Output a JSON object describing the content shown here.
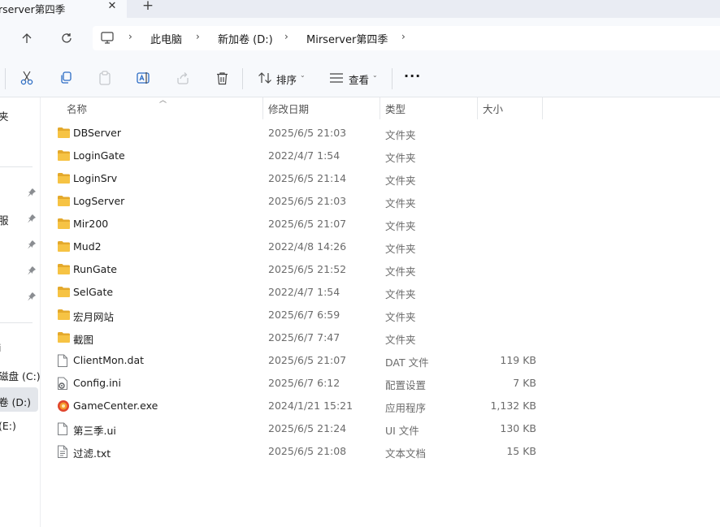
{
  "tab": {
    "title": "rserver第四季",
    "close_glyph": "✕",
    "new_glyph": "+"
  },
  "address": {
    "computer_icon": "monitor-icon",
    "crumbs": [
      "此电脑",
      "新加卷 (D:)",
      "Mirserver第四季"
    ]
  },
  "toolbar": {
    "sort_label": "排序",
    "view_label": "查看",
    "more_label": "···"
  },
  "sidebar": {
    "items": [
      {
        "label": "夹",
        "pinned": false
      },
      {
        "label": "",
        "pinned": true
      },
      {
        "label": "服",
        "pinned": true
      },
      {
        "label": "",
        "pinned": true
      },
      {
        "label": "",
        "pinned": true
      },
      {
        "label": "",
        "pinned": true
      },
      {
        "label": "i",
        "pinned": false
      },
      {
        "label": "磁盘 (C:)",
        "pinned": false
      },
      {
        "label": "卷 (D:)",
        "pinned": false
      },
      {
        "label": "(E:)",
        "pinned": false
      }
    ]
  },
  "columns": {
    "name": "名称",
    "date": "修改日期",
    "type": "类型",
    "size": "大小"
  },
  "files": [
    {
      "name": "DBServer",
      "date": "2025/6/5 21:03",
      "type": "文件夹",
      "size": "",
      "icon": "folder"
    },
    {
      "name": "LoginGate",
      "date": "2022/4/7 1:54",
      "type": "文件夹",
      "size": "",
      "icon": "folder"
    },
    {
      "name": "LoginSrv",
      "date": "2025/6/5 21:14",
      "type": "文件夹",
      "size": "",
      "icon": "folder"
    },
    {
      "name": "LogServer",
      "date": "2025/6/5 21:03",
      "type": "文件夹",
      "size": "",
      "icon": "folder"
    },
    {
      "name": "Mir200",
      "date": "2025/6/5 21:07",
      "type": "文件夹",
      "size": "",
      "icon": "folder"
    },
    {
      "name": "Mud2",
      "date": "2022/4/8 14:26",
      "type": "文件夹",
      "size": "",
      "icon": "folder"
    },
    {
      "name": "RunGate",
      "date": "2025/6/5 21:52",
      "type": "文件夹",
      "size": "",
      "icon": "folder"
    },
    {
      "name": "SelGate",
      "date": "2022/4/7 1:54",
      "type": "文件夹",
      "size": "",
      "icon": "folder"
    },
    {
      "name": "宏月网站",
      "date": "2025/6/7 6:59",
      "type": "文件夹",
      "size": "",
      "icon": "folder"
    },
    {
      "name": "截图",
      "date": "2025/6/7 7:47",
      "type": "文件夹",
      "size": "",
      "icon": "folder"
    },
    {
      "name": "ClientMon.dat",
      "date": "2025/6/5 21:07",
      "type": "DAT 文件",
      "size": "119 KB",
      "icon": "file"
    },
    {
      "name": "Config.ini",
      "date": "2025/6/7 6:12",
      "type": "配置设置",
      "size": "7 KB",
      "icon": "ini"
    },
    {
      "name": "GameCenter.exe",
      "date": "2024/1/21 15:21",
      "type": "应用程序",
      "size": "1,132 KB",
      "icon": "exe"
    },
    {
      "name": "第三季.ui",
      "date": "2025/6/5 21:24",
      "type": "UI 文件",
      "size": "130 KB",
      "icon": "file"
    },
    {
      "name": "过滤.txt",
      "date": "2025/6/5 21:08",
      "type": "文本文档",
      "size": "15 KB",
      "icon": "txt"
    }
  ],
  "colors": {
    "folder": "#f6c344",
    "folder_dark": "#e4a92b",
    "selected": "#e3e6eb"
  }
}
